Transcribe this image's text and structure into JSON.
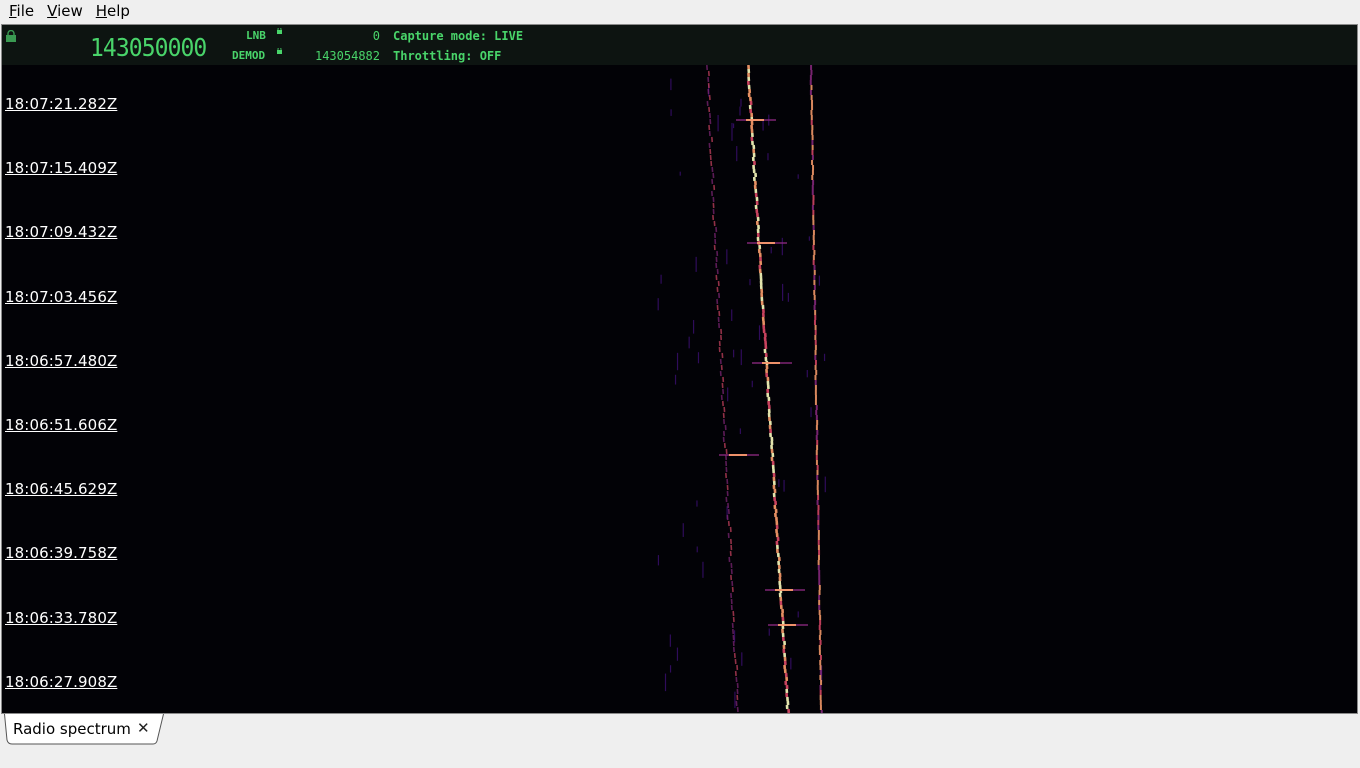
{
  "menu": {
    "file": {
      "mnemonic": "F",
      "rest": "ile"
    },
    "view": {
      "mnemonic": "V",
      "rest": "iew"
    },
    "help": {
      "mnemonic": "H",
      "rest": "elp"
    }
  },
  "status": {
    "frequency": "143050000",
    "lnb_label": "LNB",
    "lnb_value": "0",
    "demod_label": "DEMOD",
    "demod_value": "143054882",
    "capture_mode": "Capture mode: LIVE",
    "throttling": "Throttling: OFF",
    "accent_color": "#49d46a"
  },
  "waterfall": {
    "timestamps": [
      "18:07:21.282Z",
      "18:07:15.409Z",
      "18:07:09.432Z",
      "18:07:03.456Z",
      "18:06:57.480Z",
      "18:06:51.606Z",
      "18:06:45.629Z",
      "18:06:39.758Z",
      "18:06:33.780Z",
      "18:06:27.908Z"
    ],
    "colormap": [
      "#0b0320",
      "#3b0f70",
      "#8c2981",
      "#de4968",
      "#fe9f6d",
      "#fcfdbf"
    ]
  },
  "tabs": [
    {
      "label": "Radio spectrum",
      "close_icon": "close-icon"
    }
  ]
}
